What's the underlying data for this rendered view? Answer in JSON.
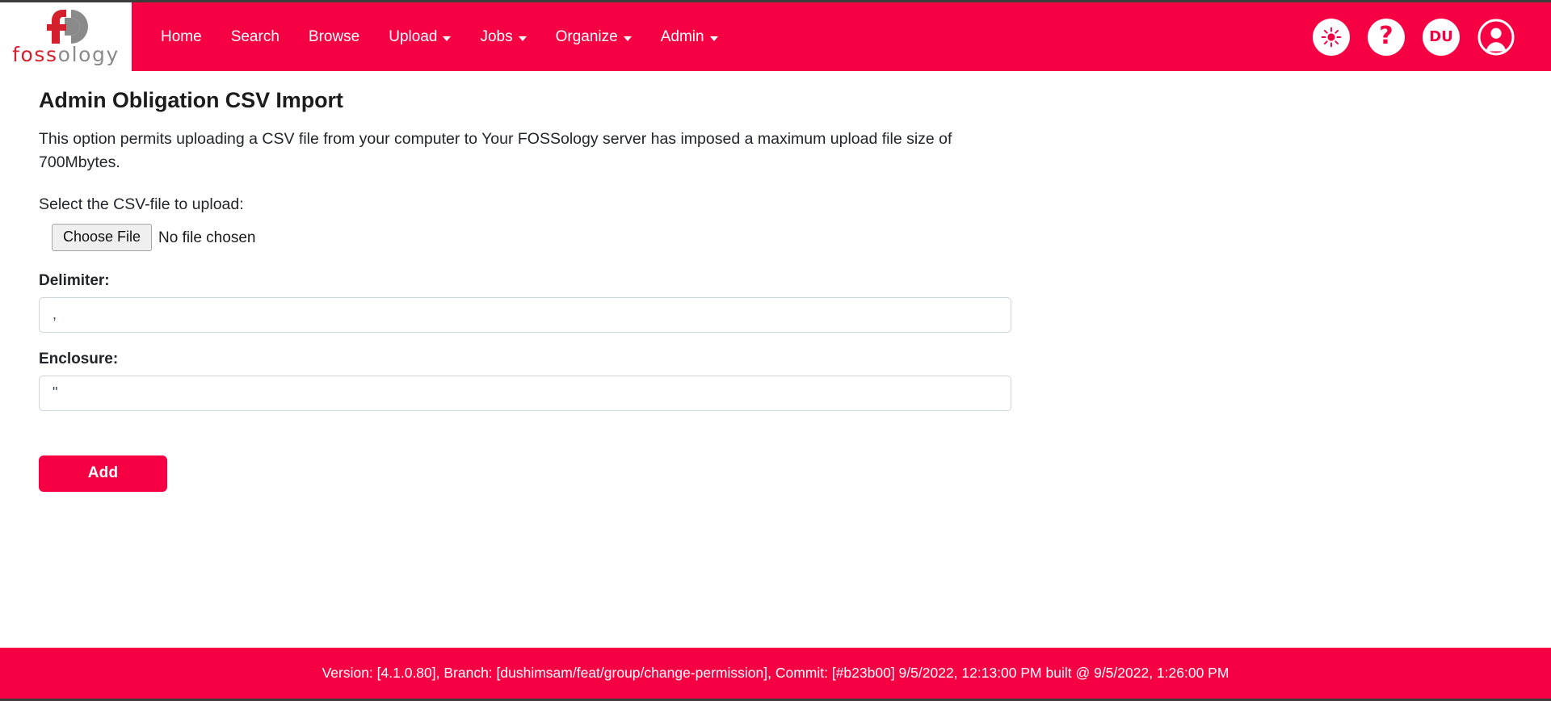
{
  "theme": {
    "brand_red": "#f50043",
    "logo_red": "#d4202c",
    "logo_grey": "#8a8a8a",
    "input_border": "#ced4da",
    "top_rule": "#3c3c3c"
  },
  "navbar": {
    "brand": {
      "word_red": "foss",
      "word_grey": "ology",
      "logo_icon": "fossology-logo-icon"
    },
    "links": [
      {
        "label": "Home",
        "has_caret": false
      },
      {
        "label": "Search",
        "has_caret": false
      },
      {
        "label": "Browse",
        "has_caret": false
      },
      {
        "label": "Upload",
        "has_caret": true
      },
      {
        "label": "Jobs",
        "has_caret": true
      },
      {
        "label": "Organize",
        "has_caret": true
      },
      {
        "label": "Admin",
        "has_caret": true
      }
    ],
    "actions": {
      "theme_toggle_icon": "sun-icon",
      "help_icon": "question-mark-icon",
      "user_initials": "DU",
      "account_icon": "user-avatar-icon"
    }
  },
  "main": {
    "title": "Admin Obligation CSV Import",
    "description": "This option permits uploading a CSV file from your computer to Your FOSSology server has imposed a maximum upload file size of 700Mbytes.",
    "file_select_label": "Select the CSV-file to upload:",
    "file_input": {
      "button_label": "Choose File",
      "status_text": "No file chosen"
    },
    "delimiter": {
      "label": "Delimiter:",
      "value": ",",
      "placeholder": ""
    },
    "enclosure": {
      "label": "Enclosure:",
      "value": "\"",
      "placeholder": ""
    },
    "submit_label": "Add"
  },
  "footer": {
    "text": "Version: [4.1.0.80], Branch: [dushimsam/feat/group/change-permission], Commit: [#b23b00] 9/5/2022, 12:13:00 PM built @ 9/5/2022, 1:26:00 PM"
  }
}
